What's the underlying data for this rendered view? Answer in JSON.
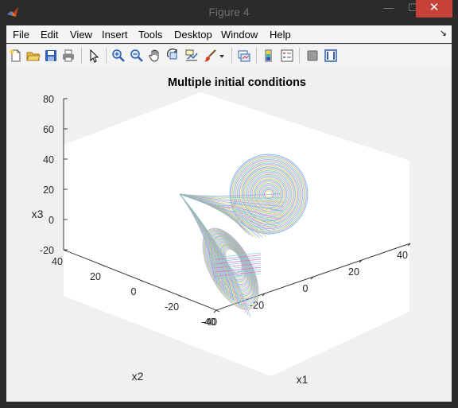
{
  "window": {
    "title": "Figure 4",
    "minimize_glyph": "—",
    "maximize_glyph": "☐",
    "close_glyph": "✕"
  },
  "menu": [
    {
      "label": "File"
    },
    {
      "label": "Edit"
    },
    {
      "label": "View"
    },
    {
      "label": "Insert"
    },
    {
      "label": "Tools"
    },
    {
      "label": "Desktop"
    },
    {
      "label": "Window"
    },
    {
      "label": "Help"
    }
  ],
  "menu_dock_glyph": "↘",
  "toolbar_icons": [
    "new-figure-icon",
    "open-file-icon",
    "save-icon",
    "print-icon",
    "edit-plot-arrow-icon",
    "zoom-in-icon",
    "zoom-out-icon",
    "pan-hand-icon",
    "rotate-3d-icon",
    "data-cursor-icon",
    "brush-icon",
    "brush-dropdown-icon",
    "link-plot-icon",
    "colorbar-icon",
    "legend-icon",
    "hide-plot-tools-icon",
    "show-plot-tools-icon"
  ],
  "colors": {
    "title_bar": "#2b2b2b",
    "close_button": "#c7433a",
    "figure_background": "#f0f0f0",
    "axes_background": "#ffffff"
  },
  "chart_data": {
    "type": "line",
    "title": "Multiple initial conditions",
    "xlabel": "x1",
    "ylabel": "x2",
    "zlabel": "x3",
    "xlim": [
      -40,
      40
    ],
    "ylim": [
      -40,
      40
    ],
    "zlim": [
      -20,
      80
    ],
    "x_ticks": [
      "-40",
      "-20",
      "0",
      "20",
      "40"
    ],
    "y_ticks": [
      "-40",
      "-20",
      "0",
      "20",
      "40"
    ],
    "z_ticks": [
      "-20",
      "0",
      "20",
      "40",
      "60",
      "80"
    ],
    "view": "3d",
    "grid": false
  }
}
